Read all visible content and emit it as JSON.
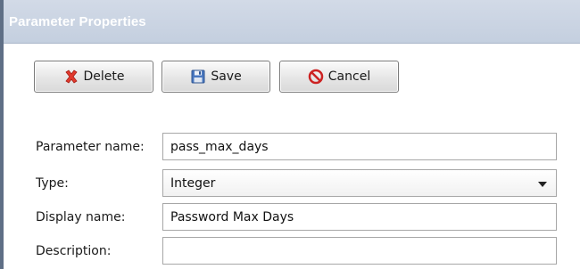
{
  "window": {
    "title": "Parameter Properties"
  },
  "toolbar": {
    "delete_label": "Delete",
    "save_label": "Save",
    "cancel_label": "Cancel"
  },
  "form": {
    "parameter_name": {
      "label": "Parameter name:",
      "value": "pass_max_days"
    },
    "type": {
      "label": "Type:",
      "value": "Integer"
    },
    "display_name": {
      "label": "Display name:",
      "value": "Password Max Days"
    },
    "description": {
      "label": "Description:",
      "value": ""
    }
  },
  "colors": {
    "titlebar": "#c8d2e2",
    "delete_icon": "#e23a2e",
    "save_icon": "#4a78c0",
    "cancel_icon": "#cc2222"
  },
  "icons": [
    "delete-x-icon",
    "floppy-disk-icon",
    "no-entry-icon",
    "chevron-down-icon"
  ]
}
